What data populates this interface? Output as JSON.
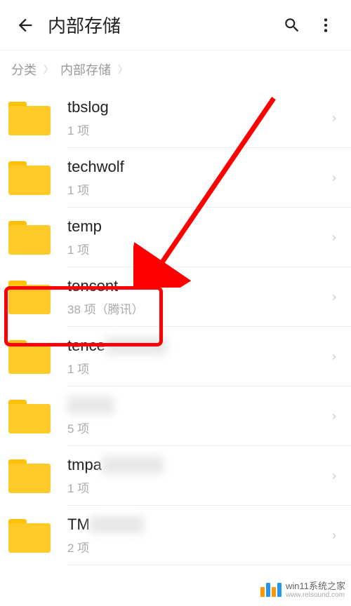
{
  "header": {
    "title": "内部存储"
  },
  "breadcrumb": {
    "items": [
      "分类",
      "内部存储"
    ]
  },
  "folders": [
    {
      "name": "tbslog",
      "meta": "1 项"
    },
    {
      "name": "techwolf",
      "meta": "1 项"
    },
    {
      "name": "temp",
      "meta": "1 项"
    },
    {
      "name": "tencent",
      "meta": "38 项（腾讯）",
      "highlighted": true
    },
    {
      "name": "tence",
      "meta": "1 项",
      "name_blurred": true
    },
    {
      "name": "",
      "meta": "5 项",
      "name_blurred": true
    },
    {
      "name": "tmpa",
      "meta": "1 项",
      "name_blurred": true
    },
    {
      "name": "TM",
      "meta": "2 项",
      "name_blurred": true
    }
  ],
  "watermark": {
    "line1": "win11系统之家",
    "line2": "www.relsound.com"
  }
}
